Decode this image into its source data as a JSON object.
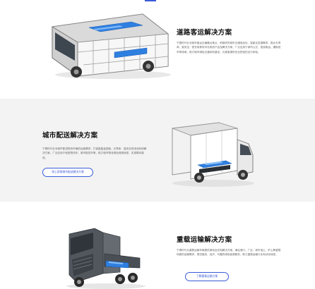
{
  "sections": [
    {
      "title": "道路客运解决方案",
      "description": "宁德时代针对城市客运交通痛点难点，积极研究城市交通电动化、智能化发展需求，推出长寿命、高安全、快充电等系列化电池产品及解决方案，广泛应用于城市公交、旅游客运、通勤班车等领域，助力城市绿色交通体系建设，为乘客提供安全舒适的出行体验。"
    },
    {
      "title": "城市配送解决方案",
      "description": "宁德时代针对城市配送物流车辆的运营需求，打造高能量密度、长寿命、高安全的电池系统解决方案，广泛应用于轻型物流车、城市配送车等，助力城市物流绿色低碳转型，实现降本增效。",
      "button_label": "线上获取城市配送解决方案"
    },
    {
      "title": "重载运输解决方案",
      "description": "宁德时代为重载运输车辆提供换电及充电解决方案，满足港口、厂区、城市渣土、矿山等重载场景的运输需求，提供高效、经济、可靠的绿色能源服务，助力重载运输行业电动化转型。",
      "button_label": "了解重载运输方案"
    }
  ],
  "colors": {
    "accent": "#3a5bd9",
    "battery": "#2f7fe0",
    "alt_background": "#f3f3f3"
  }
}
